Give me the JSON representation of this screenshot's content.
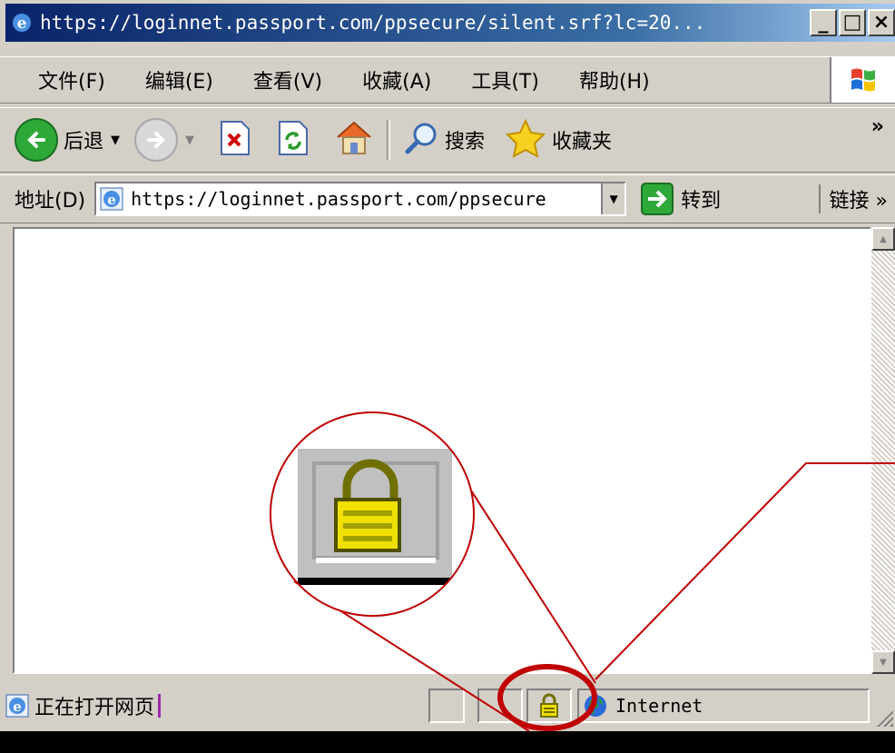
{
  "window": {
    "title": "https://loginnet.passport.com/ppsecure/silent.srf?lc=20...",
    "caption_buttons": [
      "_",
      "□",
      "×"
    ]
  },
  "menu": {
    "items": [
      "文件(F)",
      "编辑(E)",
      "查看(V)",
      "收藏(A)",
      "工具(T)",
      "帮助(H)"
    ]
  },
  "toolbar": {
    "back_label": "后退",
    "search_label": "搜索",
    "favorites_label": "收藏夹",
    "more": "»"
  },
  "address": {
    "label": "地址(D)",
    "url": "https://loginnet.passport.com/ppsecure",
    "go_label": "转到",
    "links_label": "链接 »"
  },
  "status": {
    "text": "正在打开网页",
    "zone": "Internet"
  },
  "colors": {
    "annotation": "#c00000",
    "lock_body": "#f0e000",
    "lock_shackle": "#707000"
  }
}
